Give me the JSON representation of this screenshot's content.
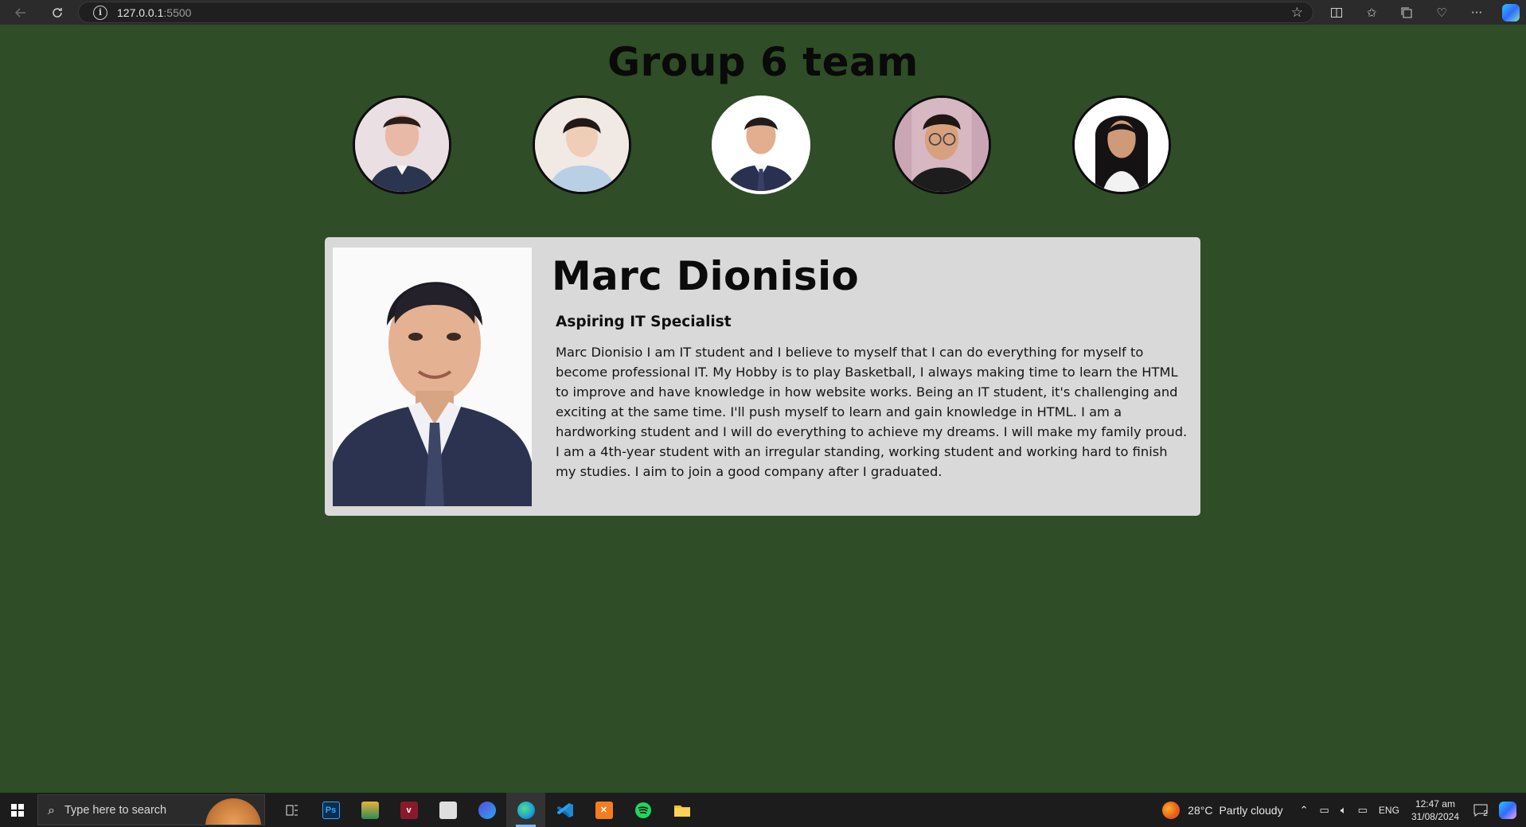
{
  "browser": {
    "back_icon": "back-arrow-icon",
    "reload_icon": "reload-icon",
    "url_host": "127.0.0.1",
    "url_port": ":5500",
    "toolbar_icons": [
      "split-screen-icon",
      "favorites-icon",
      "collections-icon",
      "browser-essentials-icon",
      "more-icon",
      "copilot-icon"
    ]
  },
  "page": {
    "title": "Group 6 team",
    "background_color": "#2f4d26",
    "members": [
      {
        "id": "member-1",
        "skin": "#e8b9a6",
        "shirt": "#2c3550",
        "bg": "#eadfe2"
      },
      {
        "id": "member-2",
        "skin": "#f0cdb6",
        "shirt": "#b9cfe6",
        "bg": "#f1e9e4"
      },
      {
        "id": "member-3",
        "skin": "#e2ae8e",
        "shirt": "#2a3050",
        "bg": "#ffffff",
        "active": true
      },
      {
        "id": "member-4",
        "skin": "#d9a07e",
        "shirt": "#1d1d1d",
        "bg": "#caa6b4"
      },
      {
        "id": "member-5",
        "skin": "#cf9a78",
        "shirt": "#ffffff",
        "bg": "#ffffff"
      }
    ]
  },
  "profile": {
    "name": "Marc Dionisio",
    "role": "Aspiring IT Specialist",
    "bio": "Marc Dionisio I am IT student and I believe to myself that I can do everything for myself to become professional IT. My Hobby is to play Basketball, I always making time to learn the HTML to improve and have knowledge in how website works. Being an IT student, it's challenging and exciting at the same time. I'll push myself to learn and gain knowledge in HTML. I am a hardworking student and I will do everything to achieve my dreams. I will make my family proud. I am a 4th-year student with an irregular standing, working student and working hard to finish my studies. I aim to join a good company after I graduated.",
    "card_color": "#d9d9d9"
  },
  "taskbar": {
    "search_placeholder": "Type here to search",
    "apps": [
      {
        "name": "task-view-icon",
        "label": "",
        "color": "#1c1c1c"
      },
      {
        "name": "photoshop-icon",
        "label": "Ps",
        "color": "#0b2d4f"
      },
      {
        "name": "sketchbook-icon",
        "label": "",
        "color": "#d1951f"
      },
      {
        "name": "app-red-icon",
        "label": "",
        "color": "#8a1a2a"
      },
      {
        "name": "game-icon",
        "label": "",
        "color": "#dedede"
      },
      {
        "name": "clipchamp-icon",
        "label": "",
        "color": "#5a4bd6"
      },
      {
        "name": "edge-icon",
        "label": "",
        "color": "#1b9fd8",
        "active": true
      },
      {
        "name": "vscode-icon",
        "label": "",
        "color": "#1f8ad2"
      },
      {
        "name": "xampp-icon",
        "label": "",
        "color": "#f57d20"
      },
      {
        "name": "spotify-icon",
        "label": "",
        "color": "#1ed760"
      },
      {
        "name": "file-explorer-icon",
        "label": "",
        "color": "#f2c12e"
      }
    ],
    "weather_temp": "28°C",
    "weather_text": "Partly cloudy",
    "language": "ENG",
    "time": "12:47 am",
    "date": "31/08/2024",
    "notification_count": "2"
  }
}
